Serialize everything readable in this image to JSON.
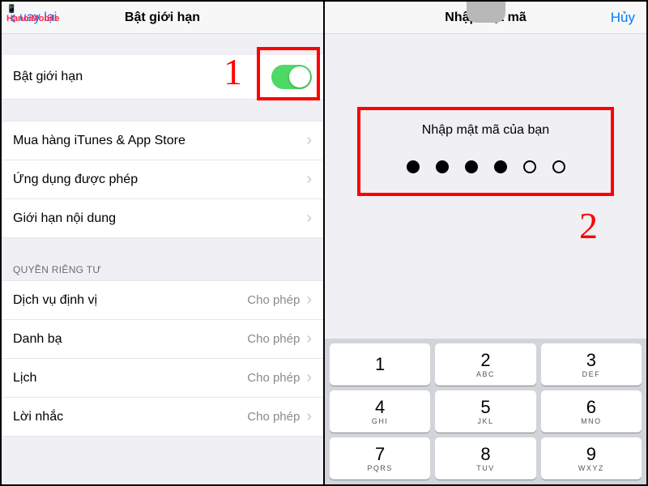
{
  "left": {
    "back": "uay lại",
    "title": "Bật giới hạn",
    "toggle_label": "Bật giới hạn",
    "items_group1": [
      {
        "label": "Mua hàng iTunes & App Store"
      },
      {
        "label": "Ứng dụng được phép"
      },
      {
        "label": "Giới hạn nội dung"
      }
    ],
    "privacy_header": "QUYỀN RIÊNG TƯ",
    "items_privacy": [
      {
        "label": "Dịch vụ định vị",
        "status": "Cho phép"
      },
      {
        "label": "Danh bạ",
        "status": "Cho phép"
      },
      {
        "label": "Lịch",
        "status": "Cho phép"
      },
      {
        "label": "Lời nhắc",
        "status": "Cho phép"
      }
    ],
    "annotation": "1"
  },
  "right": {
    "title": "Nhập mật mã",
    "cancel": "Hủy",
    "prompt": "Nhập mật mã của bạn",
    "filled_dots": 4,
    "total_dots": 6,
    "keypad": [
      {
        "n": "1",
        "l": ""
      },
      {
        "n": "2",
        "l": "ABC"
      },
      {
        "n": "3",
        "l": "DEF"
      },
      {
        "n": "4",
        "l": "GHI"
      },
      {
        "n": "5",
        "l": "JKL"
      },
      {
        "n": "6",
        "l": "MNO"
      },
      {
        "n": "7",
        "l": "PQRS"
      },
      {
        "n": "8",
        "l": "TUV"
      },
      {
        "n": "9",
        "l": "WXYZ"
      }
    ],
    "annotation": "2"
  },
  "logo_top": "📱",
  "logo_brand": "HanoiMobile"
}
